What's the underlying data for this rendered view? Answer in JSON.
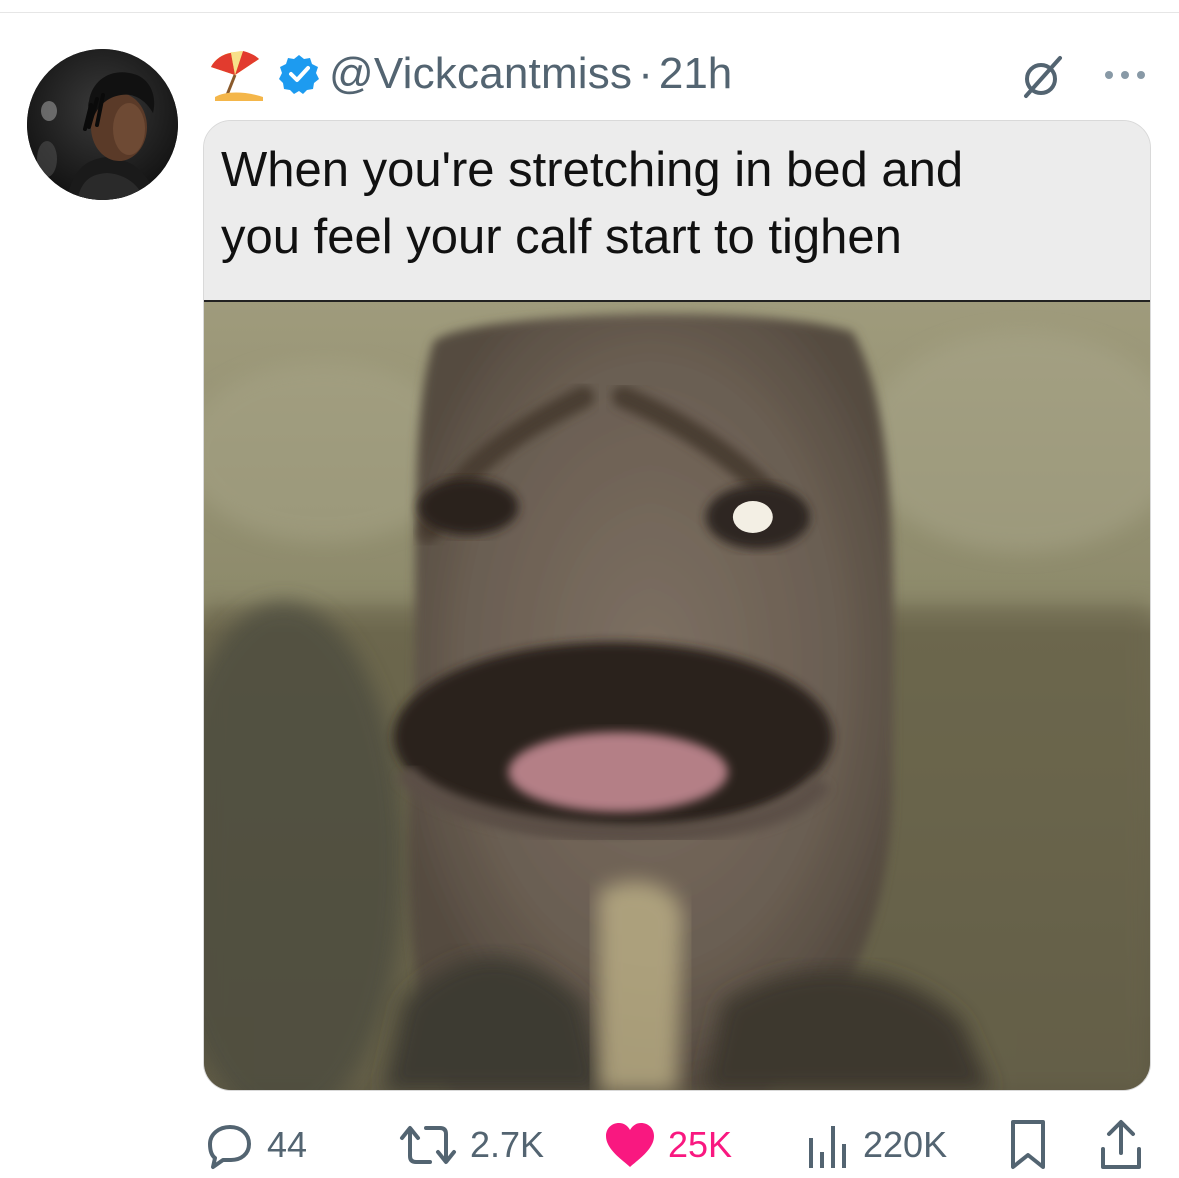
{
  "post": {
    "handle": "@Vickcantmiss",
    "separator": "·",
    "time": "21h",
    "caption_line1": "When you're stretching in bed and",
    "caption_line2": "you feel your calf start to tighen"
  },
  "actions": {
    "replies": "44",
    "reposts": "2.7K",
    "likes": "25K",
    "views": "220K"
  },
  "icons": {
    "header_emoji": "umbrella-on-ground-icon",
    "verified": "verified-badge-icon",
    "grok": "grok-icon",
    "more": "more-icon",
    "reply": "reply-icon",
    "repost": "repost-icon",
    "like": "heart-icon",
    "views": "views-icon",
    "bookmark": "bookmark-icon",
    "share": "share-icon"
  },
  "colors": {
    "verified_blue": "#1d9bf0",
    "like_pink": "#f91880",
    "secondary_text": "#536471"
  }
}
